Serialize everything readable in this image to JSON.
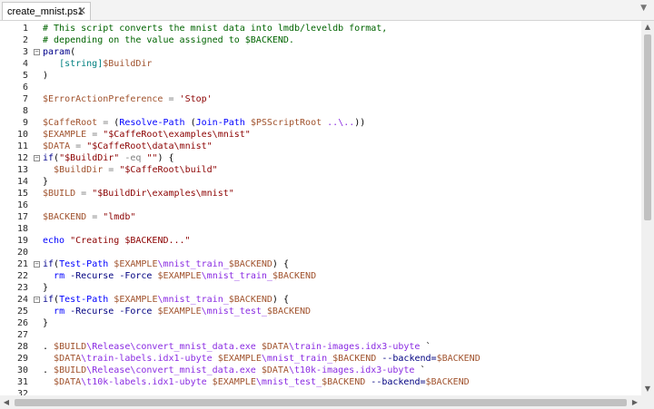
{
  "tab": {
    "title": "create_mnist.ps1",
    "close_glyph": "✕",
    "menu_glyph": "▼"
  },
  "editor": {
    "lines": [
      {
        "n": "1",
        "fold": "",
        "tokens": [
          [
            "comment",
            "# This script converts the mnist data into lmdb/leveldb format,"
          ]
        ]
      },
      {
        "n": "2",
        "fold": "",
        "tokens": [
          [
            "comment",
            "# depending on the value assigned to $BACKEND."
          ]
        ]
      },
      {
        "n": "3",
        "fold": "−",
        "tokens": [
          [
            "kw",
            "param"
          ],
          [
            "plain",
            "("
          ]
        ]
      },
      {
        "n": "4",
        "fold": "",
        "tokens": [
          [
            "plain",
            "   "
          ],
          [
            "type",
            "[string]"
          ],
          [
            "var",
            "$BuildDir"
          ]
        ]
      },
      {
        "n": "5",
        "fold": "",
        "tokens": [
          [
            "plain",
            ")"
          ]
        ]
      },
      {
        "n": "6",
        "fold": "",
        "tokens": []
      },
      {
        "n": "7",
        "fold": "",
        "tokens": [
          [
            "var",
            "$ErrorActionPreference"
          ],
          [
            "plain",
            " "
          ],
          [
            "op",
            "="
          ],
          [
            "plain",
            " "
          ],
          [
            "str",
            "'Stop'"
          ]
        ]
      },
      {
        "n": "8",
        "fold": "",
        "tokens": []
      },
      {
        "n": "9",
        "fold": "",
        "tokens": [
          [
            "var",
            "$CaffeRoot"
          ],
          [
            "plain",
            " "
          ],
          [
            "op",
            "="
          ],
          [
            "plain",
            " ("
          ],
          [
            "cmd",
            "Resolve-Path"
          ],
          [
            "plain",
            " ("
          ],
          [
            "cmd",
            "Join-Path"
          ],
          [
            "plain",
            " "
          ],
          [
            "var",
            "$PSScriptRoot"
          ],
          [
            "plain",
            " "
          ],
          [
            "path",
            "..\\.."
          ],
          [
            "plain",
            "))"
          ]
        ]
      },
      {
        "n": "10",
        "fold": "",
        "tokens": [
          [
            "var",
            "$EXAMPLE"
          ],
          [
            "plain",
            " "
          ],
          [
            "op",
            "="
          ],
          [
            "plain",
            " "
          ],
          [
            "str",
            "\"$CaffeRoot\\examples\\mnist\""
          ]
        ]
      },
      {
        "n": "11",
        "fold": "",
        "tokens": [
          [
            "var",
            "$DATA"
          ],
          [
            "plain",
            " "
          ],
          [
            "op",
            "="
          ],
          [
            "plain",
            " "
          ],
          [
            "str",
            "\"$CaffeRoot\\data\\mnist\""
          ]
        ]
      },
      {
        "n": "12",
        "fold": "−",
        "tokens": [
          [
            "kw",
            "if"
          ],
          [
            "plain",
            "("
          ],
          [
            "str",
            "\"$BuildDir\""
          ],
          [
            "plain",
            " "
          ],
          [
            "op",
            "-eq"
          ],
          [
            "plain",
            " "
          ],
          [
            "str",
            "\"\""
          ],
          [
            "plain",
            ") {"
          ]
        ]
      },
      {
        "n": "13",
        "fold": "",
        "tokens": [
          [
            "plain",
            "  "
          ],
          [
            "var",
            "$BuildDir"
          ],
          [
            "plain",
            " "
          ],
          [
            "op",
            "="
          ],
          [
            "plain",
            " "
          ],
          [
            "str",
            "\"$CaffeRoot\\build\""
          ]
        ]
      },
      {
        "n": "14",
        "fold": "",
        "tokens": [
          [
            "plain",
            "}"
          ]
        ]
      },
      {
        "n": "15",
        "fold": "",
        "tokens": [
          [
            "var",
            "$BUILD"
          ],
          [
            "plain",
            " "
          ],
          [
            "op",
            "="
          ],
          [
            "plain",
            " "
          ],
          [
            "str",
            "\"$BuildDir\\examples\\mnist\""
          ]
        ]
      },
      {
        "n": "16",
        "fold": "",
        "tokens": []
      },
      {
        "n": "17",
        "fold": "",
        "tokens": [
          [
            "var",
            "$BACKEND"
          ],
          [
            "plain",
            " "
          ],
          [
            "op",
            "="
          ],
          [
            "plain",
            " "
          ],
          [
            "str",
            "\"lmdb\""
          ]
        ]
      },
      {
        "n": "18",
        "fold": "",
        "tokens": []
      },
      {
        "n": "19",
        "fold": "",
        "tokens": [
          [
            "cmd",
            "echo"
          ],
          [
            "plain",
            " "
          ],
          [
            "str",
            "\"Creating $BACKEND...\""
          ]
        ]
      },
      {
        "n": "20",
        "fold": "",
        "tokens": []
      },
      {
        "n": "21",
        "fold": "−",
        "tokens": [
          [
            "kw",
            "if"
          ],
          [
            "plain",
            "("
          ],
          [
            "cmd",
            "Test-Path"
          ],
          [
            "plain",
            " "
          ],
          [
            "var",
            "$EXAMPLE"
          ],
          [
            "path",
            "\\mnist_train_"
          ],
          [
            "var",
            "$BACKEND"
          ],
          [
            "plain",
            ") {"
          ]
        ]
      },
      {
        "n": "22",
        "fold": "",
        "tokens": [
          [
            "plain",
            "  "
          ],
          [
            "cmd",
            "rm"
          ],
          [
            "plain",
            " "
          ],
          [
            "param",
            "-Recurse"
          ],
          [
            "plain",
            " "
          ],
          [
            "param",
            "-Force"
          ],
          [
            "plain",
            " "
          ],
          [
            "var",
            "$EXAMPLE"
          ],
          [
            "path",
            "\\mnist_train_"
          ],
          [
            "var",
            "$BACKEND"
          ]
        ]
      },
      {
        "n": "23",
        "fold": "",
        "tokens": [
          [
            "plain",
            "}"
          ]
        ]
      },
      {
        "n": "24",
        "fold": "−",
        "tokens": [
          [
            "kw",
            "if"
          ],
          [
            "plain",
            "("
          ],
          [
            "cmd",
            "Test-Path"
          ],
          [
            "plain",
            " "
          ],
          [
            "var",
            "$EXAMPLE"
          ],
          [
            "path",
            "\\mnist_train_"
          ],
          [
            "var",
            "$BACKEND"
          ],
          [
            "plain",
            ") {"
          ]
        ]
      },
      {
        "n": "25",
        "fold": "",
        "tokens": [
          [
            "plain",
            "  "
          ],
          [
            "cmd",
            "rm"
          ],
          [
            "plain",
            " "
          ],
          [
            "param",
            "-Recurse"
          ],
          [
            "plain",
            " "
          ],
          [
            "param",
            "-Force"
          ],
          [
            "plain",
            " "
          ],
          [
            "var",
            "$EXAMPLE"
          ],
          [
            "path",
            "\\mnist_test_"
          ],
          [
            "var",
            "$BACKEND"
          ]
        ]
      },
      {
        "n": "26",
        "fold": "",
        "tokens": [
          [
            "plain",
            "}"
          ]
        ]
      },
      {
        "n": "27",
        "fold": "",
        "tokens": []
      },
      {
        "n": "28",
        "fold": "",
        "tokens": [
          [
            "plain",
            ". "
          ],
          [
            "var",
            "$BUILD"
          ],
          [
            "path",
            "\\Release\\convert_mnist_data.exe"
          ],
          [
            "plain",
            " "
          ],
          [
            "var",
            "$DATA"
          ],
          [
            "path",
            "\\train-images.idx3-ubyte"
          ],
          [
            "plain",
            " `"
          ]
        ]
      },
      {
        "n": "29",
        "fold": "",
        "tokens": [
          [
            "plain",
            "  "
          ],
          [
            "var",
            "$DATA"
          ],
          [
            "path",
            "\\train-labels.idx1-ubyte"
          ],
          [
            "plain",
            " "
          ],
          [
            "var",
            "$EXAMPLE"
          ],
          [
            "path",
            "\\mnist_train_"
          ],
          [
            "var",
            "$BACKEND"
          ],
          [
            "plain",
            " "
          ],
          [
            "param",
            "--backend="
          ],
          [
            "var",
            "$BACKEND"
          ]
        ]
      },
      {
        "n": "30",
        "fold": "",
        "tokens": [
          [
            "plain",
            ". "
          ],
          [
            "var",
            "$BUILD"
          ],
          [
            "path",
            "\\Release\\convert_mnist_data.exe"
          ],
          [
            "plain",
            " "
          ],
          [
            "var",
            "$DATA"
          ],
          [
            "path",
            "\\t10k-images.idx3-ubyte"
          ],
          [
            "plain",
            " `"
          ]
        ]
      },
      {
        "n": "31",
        "fold": "",
        "tokens": [
          [
            "plain",
            "  "
          ],
          [
            "var",
            "$DATA"
          ],
          [
            "path",
            "\\t10k-labels.idx1-ubyte"
          ],
          [
            "plain",
            " "
          ],
          [
            "var",
            "$EXAMPLE"
          ],
          [
            "path",
            "\\mnist_test_"
          ],
          [
            "var",
            "$BACKEND"
          ],
          [
            "plain",
            " "
          ],
          [
            "param",
            "--backend="
          ],
          [
            "var",
            "$BACKEND"
          ]
        ]
      },
      {
        "n": "32",
        "fold": "",
        "tokens": []
      }
    ]
  },
  "scrollbars": {
    "up": "▲",
    "down": "▼",
    "left": "◀",
    "right": "▶"
  },
  "colors": {
    "comment": "#006400",
    "variable": "#a0522d",
    "string": "#8b0000",
    "keyword": "#00008b",
    "command": "#0000ff"
  }
}
